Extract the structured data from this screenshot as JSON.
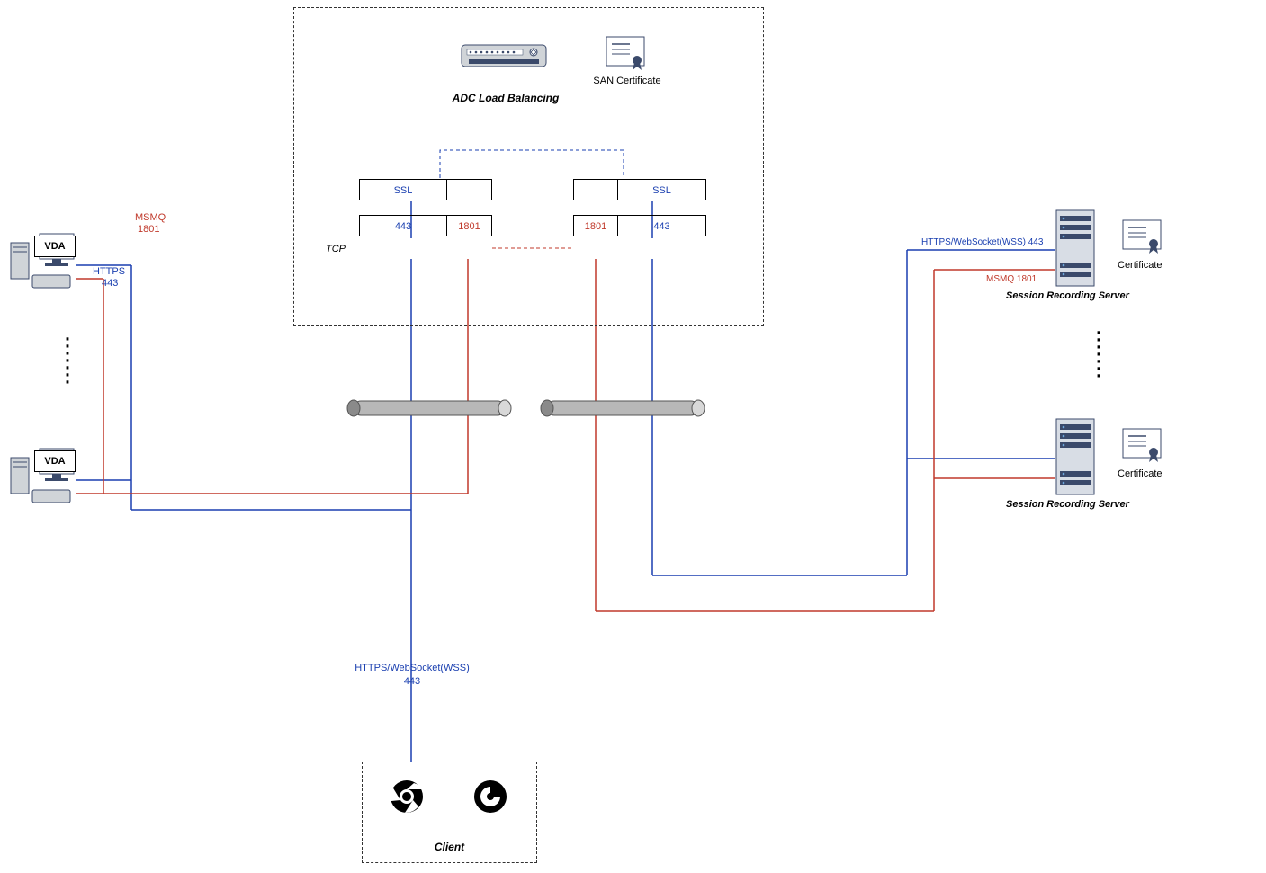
{
  "adc": {
    "title": "ADC Load Balancing",
    "san_label": "SAN Certificate",
    "tcp_label": "TCP",
    "ssl": "SSL",
    "port443": "443",
    "port1801": "1801"
  },
  "vda": {
    "label": "VDA",
    "msmq": "MSMQ",
    "msmq_port": "1801",
    "https": "HTTPS",
    "https_port": "443"
  },
  "client": {
    "title": "Client",
    "conn_label": "HTTPS/WebSocket(WSS)",
    "conn_port": "443"
  },
  "server": {
    "title": "Session Recording Server",
    "https_label": "HTTPS/WebSocket(WSS)  443",
    "msmq_label": "MSMQ  1801",
    "cert_label": "Certificate"
  }
}
